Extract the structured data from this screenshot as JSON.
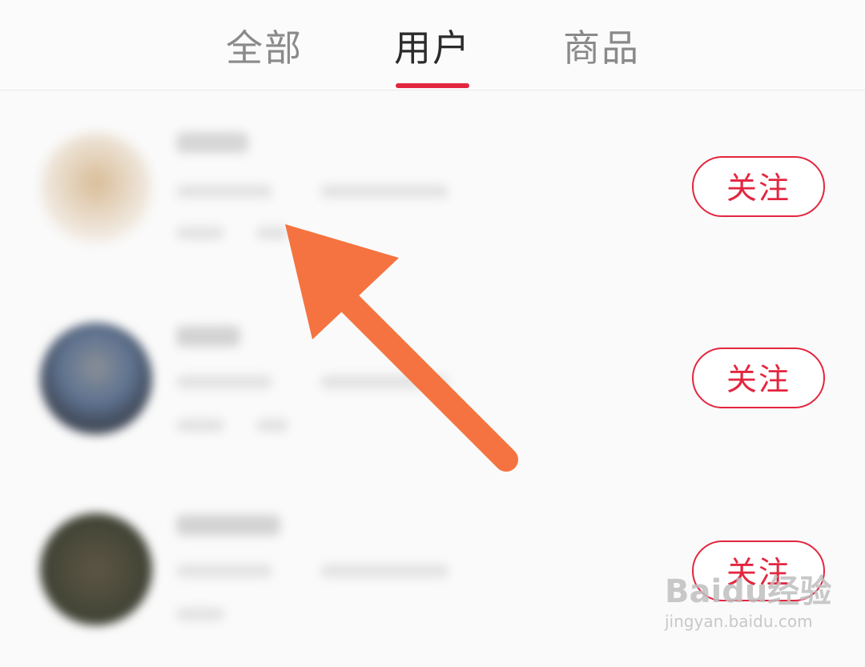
{
  "tabs": [
    {
      "label": "全部",
      "active": false
    },
    {
      "label": "用户",
      "active": true
    },
    {
      "label": "商品",
      "active": false
    }
  ],
  "accent_color": "#e3263f",
  "annotation_arrow_color": "#f47340",
  "users": [
    {
      "follow_label": "关注",
      "avatar_color": "#e6d2b8"
    },
    {
      "follow_label": "关注",
      "avatar_color": "#6b7f99"
    },
    {
      "follow_label": "关注",
      "avatar_color": "#4e4a3c"
    }
  ],
  "watermark": {
    "logo": "Baidu经验",
    "url": "jingyan.baidu.com"
  }
}
